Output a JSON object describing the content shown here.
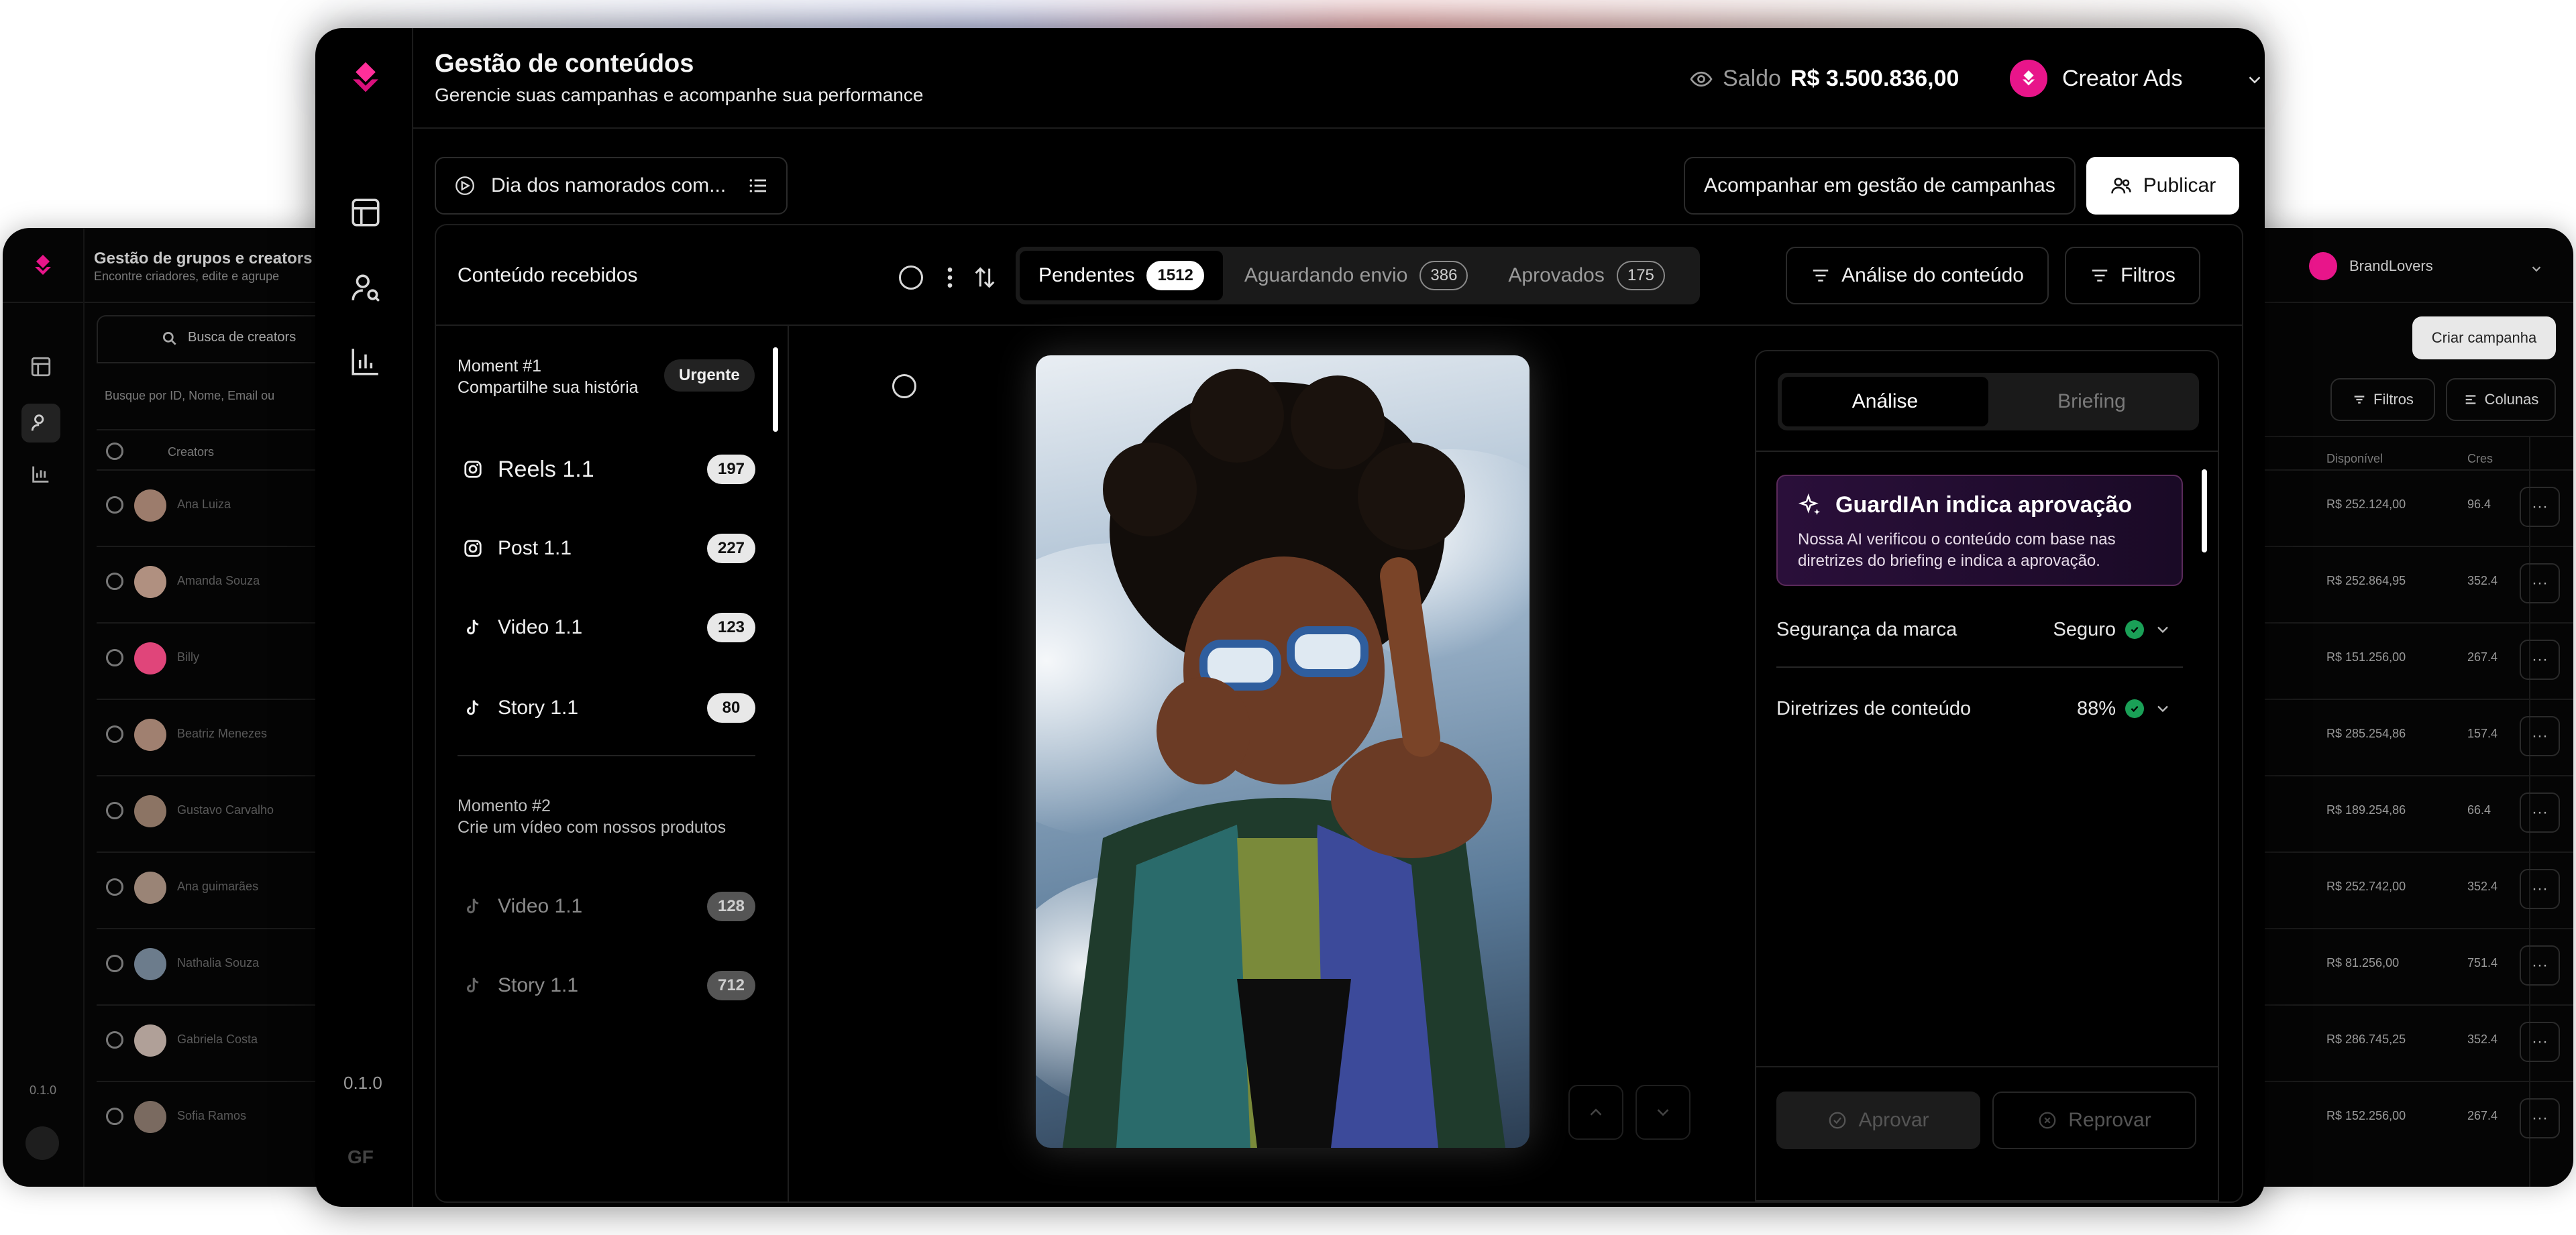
{
  "app": {
    "title": "Gestão de conteúdos",
    "subtitle": "Gerencie suas campanhas e acompanhe sua performance",
    "version": "0.1.0",
    "user_initials": "GF",
    "accent": "#e8158a"
  },
  "header": {
    "balance_label": "Saldo",
    "balance_value": "R$ 3.500.836,00",
    "account_name": "Creator Ads"
  },
  "toolbar": {
    "campaign": "Dia dos namorados com...",
    "track_label": "Acompanhar em gestão de campanhas",
    "publish_label": "Publicar"
  },
  "panel": {
    "title": "Conteúdo recebidos",
    "tabs": [
      {
        "label": "Pendentes",
        "count": "1512"
      },
      {
        "label": "Aguardando envio",
        "count": "386"
      },
      {
        "label": "Aprovados",
        "count": "175"
      }
    ],
    "analysis_button": "Análise do conteúdo",
    "filters_button": "Filtros"
  },
  "moments": [
    {
      "title": "Moment #1",
      "subtitle": "Compartilhe sua história",
      "badge": "Urgente",
      "items": [
        {
          "label": "Reels 1.1",
          "count": "197",
          "platform": "instagram-icon"
        },
        {
          "label": "Post 1.1",
          "count": "227",
          "platform": "instagram-icon"
        },
        {
          "label": "Video 1.1",
          "count": "123",
          "platform": "tiktok-icon"
        },
        {
          "label": "Story 1.1",
          "count": "80",
          "platform": "tiktok-icon"
        }
      ]
    },
    {
      "title": "Momento #2",
      "subtitle": "Crie um vídeo com nossos produtos",
      "items": [
        {
          "label": "Video 1.1",
          "count": "128",
          "platform": "tiktok-icon"
        },
        {
          "label": "Story 1.1",
          "count": "712",
          "platform": "tiktok-icon"
        }
      ]
    }
  ],
  "analysis": {
    "tabs": [
      "Análise",
      "Briefing"
    ],
    "ai_title": "GuardIAn indica aprovação",
    "ai_desc": "Nossa AI verificou o conteúdo com base nas diretrizes do briefing e indica a aprovação.",
    "rows": [
      {
        "label": "Segurança da marca",
        "value": "Seguro"
      },
      {
        "label": "Diretrizes de conteúdo",
        "value": "88%"
      }
    ],
    "approve_label": "Aprovar",
    "reject_label": "Reprovar"
  },
  "background_left": {
    "title": "Gestão de grupos e creators",
    "subtitle": "Encontre criadores, edite e agrupe",
    "search": "Busca de creators",
    "search_input": "Busque por ID, Nome, Email ou",
    "column": "Creators",
    "version": "0.1.0",
    "rows": [
      "Ana Luiza",
      "Amanda Souza",
      "Billy",
      "Beatriz Menezes",
      "Gustavo Carvalho",
      "Ana guimarães",
      "Nathalia Souza",
      "Gabriela Costa",
      "Sofia Ramos"
    ]
  },
  "background_right": {
    "account": "BrandLovers",
    "create_button": "Criar campanha",
    "filters_button": "Filtros",
    "columns_button": "Colunas",
    "column": "Disponível",
    "column2": "Cres",
    "rows": [
      {
        "value": "R$ 252.124,00",
        "extra": "96.4"
      },
      {
        "value": "R$ 252.864,95",
        "extra": "352.4"
      },
      {
        "value": "R$ 151.256,00",
        "extra": "267.4"
      },
      {
        "value": "R$ 285.254,86",
        "extra": "157.4"
      },
      {
        "value": "R$ 189.254,86",
        "extra": "66.4"
      },
      {
        "value": "R$ 252.742,00",
        "extra": "352.4"
      },
      {
        "value": "R$ 81.256,00",
        "extra": "751.4"
      },
      {
        "value": "R$ 286.745,25",
        "extra": "352.4"
      },
      {
        "value": "R$ 152.256,00",
        "extra": "267.4"
      }
    ]
  }
}
